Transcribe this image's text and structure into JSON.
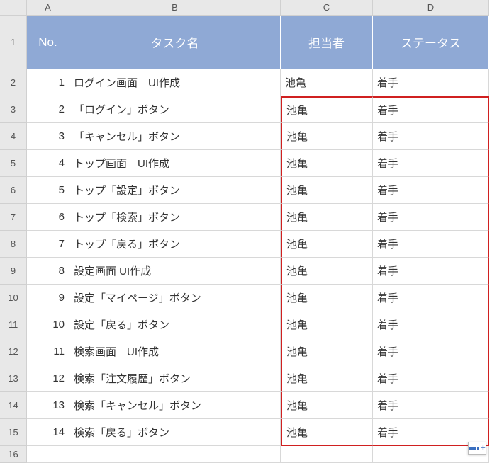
{
  "colLetters": [
    "A",
    "B",
    "C",
    "D"
  ],
  "headers": {
    "no": "No.",
    "task": "タスク名",
    "assignee": "担当者",
    "status": "ステータス"
  },
  "rows": [
    {
      "no": "1",
      "task": "ログイン画面　UI作成",
      "assignee": "池亀",
      "status": "着手"
    },
    {
      "no": "2",
      "task": "「ログイン」ボタン",
      "assignee": "池亀",
      "status": "着手"
    },
    {
      "no": "3",
      "task": "「キャンセル」ボタン",
      "assignee": "池亀",
      "status": "着手"
    },
    {
      "no": "4",
      "task": "トップ画面　UI作成",
      "assignee": "池亀",
      "status": "着手"
    },
    {
      "no": "5",
      "task": "トップ「設定」ボタン",
      "assignee": "池亀",
      "status": "着手"
    },
    {
      "no": "6",
      "task": "トップ「検索」ボタン",
      "assignee": "池亀",
      "status": "着手"
    },
    {
      "no": "7",
      "task": "トップ「戻る」ボタン",
      "assignee": "池亀",
      "status": "着手"
    },
    {
      "no": "8",
      "task": "設定画面 UI作成",
      "assignee": "池亀",
      "status": "着手"
    },
    {
      "no": "9",
      "task": "設定「マイページ」ボタン",
      "assignee": "池亀",
      "status": "着手"
    },
    {
      "no": "10",
      "task": "設定「戻る」ボタン",
      "assignee": "池亀",
      "status": "着手"
    },
    {
      "no": "11",
      "task": "検索画面　UI作成",
      "assignee": "池亀",
      "status": "着手"
    },
    {
      "no": "12",
      "task": "検索「注文履歴」ボタン",
      "assignee": "池亀",
      "status": "着手"
    },
    {
      "no": "13",
      "task": "検索「キャンセル」ボタン",
      "assignee": "池亀",
      "status": "着手"
    },
    {
      "no": "14",
      "task": "検索「戻る」ボタン",
      "assignee": "池亀",
      "status": "着手"
    }
  ],
  "redbox": {
    "rowStart": 3,
    "rowEnd": 15
  }
}
